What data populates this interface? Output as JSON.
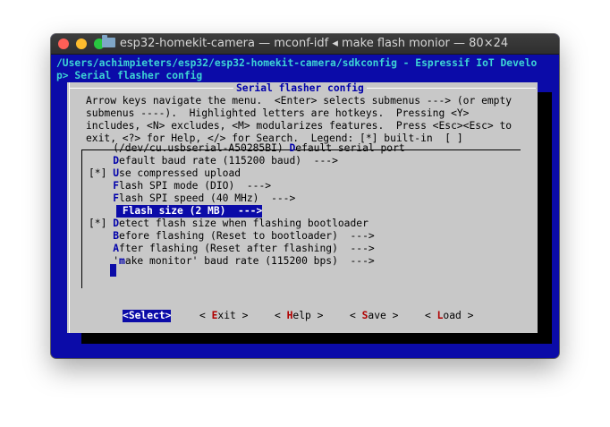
{
  "window": {
    "title": "esp32-homekit-camera — mconf-idf ◂ make flash monior — 80×24",
    "colors": {
      "terminal_bg": "#0b0ba8",
      "dialog_bg": "#c8c8c8",
      "highlight": "#0b0ba8",
      "hotkey_blue": "#0000aa",
      "hotkey_red": "#b00000"
    }
  },
  "terminal": {
    "line1": "/Users/achimpieters/esp32/esp32-homekit-camera/sdkconfig - Espressif IoT Develo",
    "line2": "p> Serial flasher config"
  },
  "dialog": {
    "title": "Serial flasher config",
    "help": [
      "Arrow keys navigate the menu.  <Enter> selects submenus ---> (or empty",
      "submenus ----).  Highlighted letters are hotkeys.  Pressing <Y>",
      "includes, <N> excludes, <M> modularizes features.  Press <Esc><Esc> to",
      "exit, <?> for Help, </> for Search.  Legend: [*] built-in  [ ]"
    ],
    "items": [
      {
        "pre": "    (/dev/cu.usbserial-A50285BI) ",
        "hot": "D",
        "post": "efault serial port"
      },
      {
        "pre": "    ",
        "hot": "D",
        "post": "efault baud rate (115200 baud)  --->"
      },
      {
        "pre": "[*] ",
        "hot": "U",
        "post": "se compressed upload"
      },
      {
        "pre": "    ",
        "hot": "F",
        "post": "lash SPI mode (DIO)  --->"
      },
      {
        "pre": "    ",
        "hot": "F",
        "post": "lash SPI speed (40 MHz)  --->"
      },
      {
        "pre": "    ",
        "hot": "F",
        "post": "lash size (2 MB)  --->"
      },
      {
        "pre": "[*] ",
        "hot": "D",
        "post": "etect flash size when flashing bootloader"
      },
      {
        "pre": "    ",
        "hot": "B",
        "post": "efore flashing (Reset to bootloader)  --->"
      },
      {
        "pre": "    ",
        "hot": "A",
        "post": "fter flashing (Reset after flashing)  --->"
      },
      {
        "pre": "    '",
        "hot": "m",
        "post": "ake monitor' baud rate (115200 bps)  --->"
      }
    ],
    "selected_index": 5,
    "buttons": [
      {
        "pre": "<",
        "hot": "S",
        "post": "elect>"
      },
      {
        "pre": "< ",
        "hot": "E",
        "post": "xit >"
      },
      {
        "pre": "< ",
        "hot": "H",
        "post": "elp >"
      },
      {
        "pre": "< ",
        "hot": "S",
        "post": "ave >"
      },
      {
        "pre": "< ",
        "hot": "L",
        "post": "oad >"
      }
    ]
  }
}
